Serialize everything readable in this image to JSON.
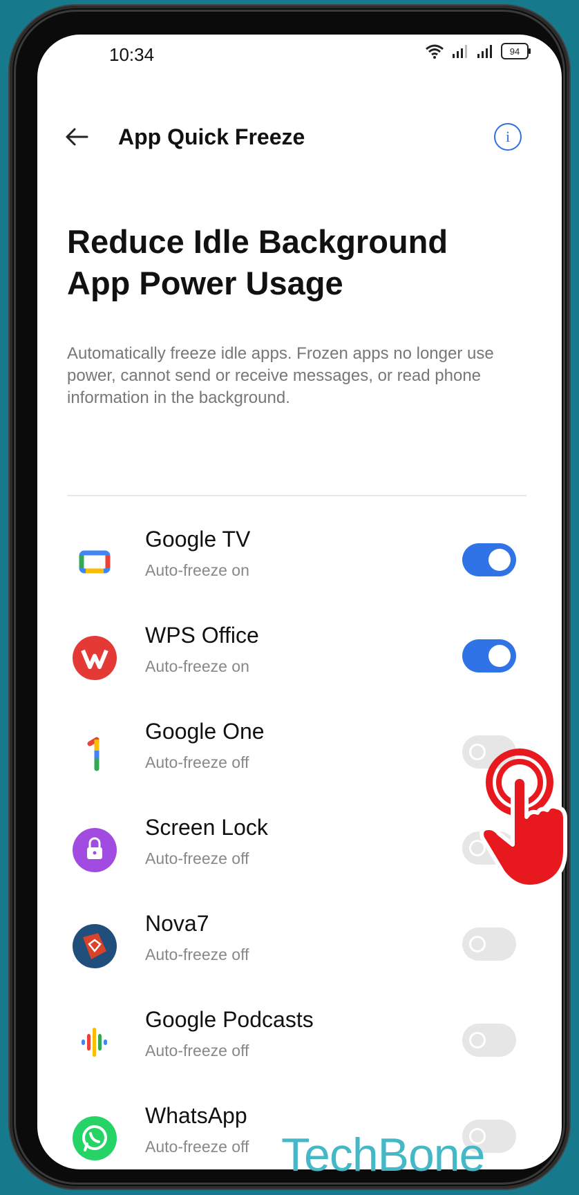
{
  "status_bar": {
    "time": "10:34",
    "battery": "94"
  },
  "app_bar": {
    "title": "App Quick Freeze"
  },
  "headline": "Reduce Idle Background App Power Usage",
  "description": "Automatically freeze idle apps. Frozen apps no longer use power, cannot send or receive messages, or read phone information in the background.",
  "apps": [
    {
      "name": "Google TV",
      "status": "Auto-freeze on",
      "enabled": true,
      "icon": "google-tv-icon"
    },
    {
      "name": "WPS Office",
      "status": "Auto-freeze on",
      "enabled": true,
      "icon": "wps-office-icon"
    },
    {
      "name": "Google One",
      "status": "Auto-freeze off",
      "enabled": false,
      "icon": "google-one-icon"
    },
    {
      "name": "Screen Lock",
      "status": "Auto-freeze off",
      "enabled": false,
      "icon": "screen-lock-icon"
    },
    {
      "name": "Nova7",
      "status": "Auto-freeze off",
      "enabled": false,
      "icon": "nova7-icon"
    },
    {
      "name": "Google Podcasts",
      "status": "Auto-freeze off",
      "enabled": false,
      "icon": "google-podcasts-icon"
    },
    {
      "name": "WhatsApp",
      "status": "Auto-freeze off",
      "enabled": false,
      "icon": "whatsapp-icon"
    }
  ],
  "watermark": "TechBone",
  "colors": {
    "accent": "#2f73e6",
    "background": "#167a8c",
    "pointer": "#e8191e"
  }
}
